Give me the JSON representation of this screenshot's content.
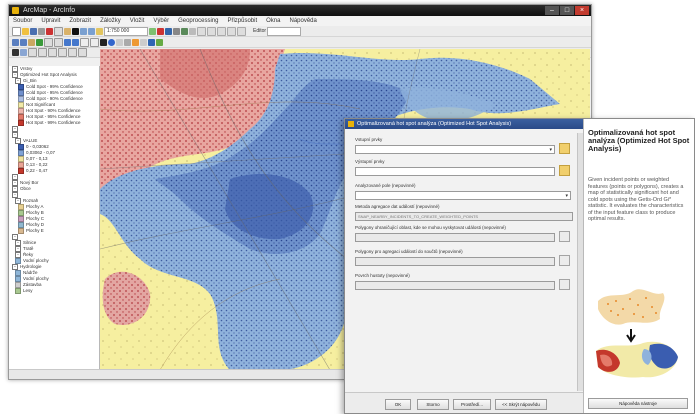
{
  "app": {
    "title": "ArcMap - ArcInfo",
    "menus": [
      "Soubor",
      "Upravit",
      "Zobrazit",
      "Záložky",
      "Vložit",
      "Výběr",
      "Geoprocessing",
      "Přizpůsobit",
      "Okna",
      "Nápověda"
    ],
    "scale_value": "1:750 000",
    "editor_label": "Editor"
  },
  "toc": {
    "rows": [
      {
        "label": "Vrstvy",
        "swatch": ""
      },
      {
        "label": "Optimized Hot Spot Analysis",
        "swatch": ""
      },
      {
        "label": "Gi_Bin",
        "swatch": ""
      },
      {
        "label": "Cold Spot - 99% Confidence",
        "swatch": "#3a5db0"
      },
      {
        "label": "Cold Spot - 95% Confidence",
        "swatch": "#6f8fcc"
      },
      {
        "label": "Cold Spot - 90% Confidence",
        "swatch": "#aec0e4"
      },
      {
        "label": "Not Significant",
        "swatch": "#f2eaa8"
      },
      {
        "label": "Hot Spot - 90% Confidence",
        "swatch": "#f0b7ad"
      },
      {
        "label": "Hot Spot - 95% Confidence",
        "swatch": "#e47a6a"
      },
      {
        "label": "Hot Spot - 99% Confidence",
        "swatch": "#c4382c"
      },
      {
        "label": "",
        "swatch": ""
      },
      {
        "label": "",
        "swatch": ""
      },
      {
        "label": "VALUE",
        "swatch": ""
      },
      {
        "label": "0 - 0,03062",
        "swatch": "#3a5db0"
      },
      {
        "label": "0,03062 - 0,07",
        "swatch": "#7fa2d6"
      },
      {
        "label": "0,07 - 0,13",
        "swatch": "#f0e3a0"
      },
      {
        "label": "0,13 - 0,22",
        "swatch": "#eaa595"
      },
      {
        "label": "0,22 - 0,47",
        "swatch": "#c4382c"
      },
      {
        "label": "",
        "swatch": ""
      },
      {
        "label": "Nový Bor",
        "swatch": ""
      },
      {
        "label": "Obce",
        "swatch": ""
      },
      {
        "label": "",
        "swatch": ""
      },
      {
        "label": "Rozsah",
        "swatch": ""
      },
      {
        "label": "Plochy A",
        "swatch": "#e8d090"
      },
      {
        "label": "Plochy B",
        "swatch": "#a8c890"
      },
      {
        "label": "Plochy C",
        "swatch": "#c9a0c0"
      },
      {
        "label": "Plochy D",
        "swatch": "#90b8d0"
      },
      {
        "label": "Plochy E",
        "swatch": "#d8b890"
      },
      {
        "label": "",
        "swatch": ""
      },
      {
        "label": "Silnice",
        "swatch": ""
      },
      {
        "label": "Tratě",
        "swatch": ""
      },
      {
        "label": "Řeky",
        "swatch": ""
      },
      {
        "label": "Vodní plochy",
        "swatch": "#8fb6d8"
      },
      {
        "label": "Hydrologie",
        "swatch": ""
      },
      {
        "label": "Nádrže",
        "swatch": "#8fb6d8"
      },
      {
        "label": "Vodní plochy",
        "swatch": "#8fb6d8"
      },
      {
        "label": "Zástavba",
        "swatch": "#cfcfcf"
      },
      {
        "label": "Lesy",
        "swatch": "#a8c890"
      }
    ]
  },
  "dialog": {
    "title": "Optimalizovaná hot spot analýza (Optimized Hot Spot Analysis)",
    "fields": [
      {
        "label": "Vstupní prvky",
        "value": "",
        "kind": "dropdown-folder"
      },
      {
        "label": "Výstupní prvky",
        "value": "",
        "kind": "text-folder"
      },
      {
        "label": "Analyzované pole (nepovinné)",
        "value": "",
        "kind": "dropdown"
      },
      {
        "label": "Metoda agregace dat událostí (nepovinné)",
        "value": "SNAP_NEARBY_INCIDENTS_TO_CREATE_WEIGHTED_POINTS",
        "kind": "dropdown-grey"
      },
      {
        "label": "Polygony ohraničující oblast, kde se mohou vyskytovat události (nepovinné)",
        "value": "",
        "kind": "dropdown-folder-grey"
      },
      {
        "label": "Polygony pro agregaci událostí do součtů (nepovinné)",
        "value": "",
        "kind": "dropdown-folder-grey"
      },
      {
        "label": "Povrch hustoty (nepovinné)",
        "value": "",
        "kind": "text-folder-grey"
      }
    ],
    "buttons": {
      "ok": "OK",
      "cancel": "Storno",
      "environments": "Prostředí...",
      "hide_help": "<< Skrýt nápovědu",
      "tool_help": "Nápověda nástroje"
    },
    "help": {
      "title": "Optimalizovaná hot spot analýza (Optimized Hot Spot Analysis)",
      "text": "Given incident points or weighted features (points or polygons), creates a map of statistically significant hot and cold spots using the Getis-Ord Gi* statistic. It evaluates the characteristics of the input feature class to produce optimal results."
    }
  },
  "colors": {
    "hot": "#c4382c",
    "hot_light": "#e9a89c",
    "cold": "#3a5db0",
    "cold_light": "#8fb2dc",
    "neutral": "#f6efa0"
  }
}
